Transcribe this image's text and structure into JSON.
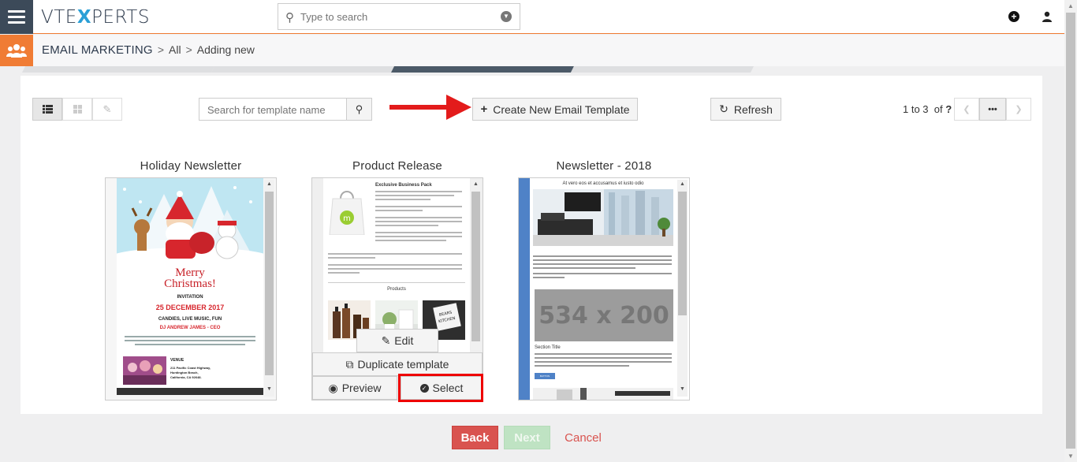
{
  "header": {
    "logo_left": "VTE",
    "logo_x": "X",
    "logo_right": "PERTS",
    "search_placeholder": "Type to search"
  },
  "breadcrumb": {
    "module": "EMAIL MARKETING",
    "level1": "All",
    "level2": "Adding new",
    "separator": ">"
  },
  "toolbar": {
    "template_search_placeholder": "Search for template name",
    "create_label": "Create New Email Template",
    "refresh_label": "Refresh",
    "pager_range": "1 to 3",
    "pager_of": "of",
    "pager_total": "?",
    "pager_more": "•••"
  },
  "templates": [
    {
      "title": "Holiday Newsletter",
      "merry": "Merry",
      "christmas": "Christmas!",
      "invitation": "INVITATION",
      "date": "25 DECEMBER 2017",
      "subtitle": "CANDIES, LIVE MUSIC, FUN",
      "dj": "DJ ANDREW JAMES - CEO",
      "venue": "VENUE",
      "address1": "211 Pacific Coast Highway,",
      "address2": "Huntington Beach,",
      "address3": "California, CA 92648."
    },
    {
      "title": "Product Release",
      "heading": "Exclusive Business Pack",
      "products_heading": "Products",
      "shop_sign_line1": "BEARS",
      "shop_sign_line2": "KITCHEN",
      "edit_label": "Edit",
      "duplicate_label": "Duplicate template",
      "preview_label": "Preview",
      "select_label": "Select"
    },
    {
      "title": "Newsletter - 2018",
      "heading": "At vero eos et accusamus et iusto odio",
      "placeholder": "534 x 200",
      "section_title": "Section Title",
      "button": "BUTTON"
    }
  ],
  "footer": {
    "back_label": "Back",
    "next_label": "Next",
    "cancel_label": "Cancel"
  },
  "colors": {
    "accent_orange": "#f07c34",
    "nav_dark": "#3c4a59",
    "back_red": "#d9534f",
    "next_green": "#bfe3c3",
    "highlight_red": "#e00000"
  }
}
